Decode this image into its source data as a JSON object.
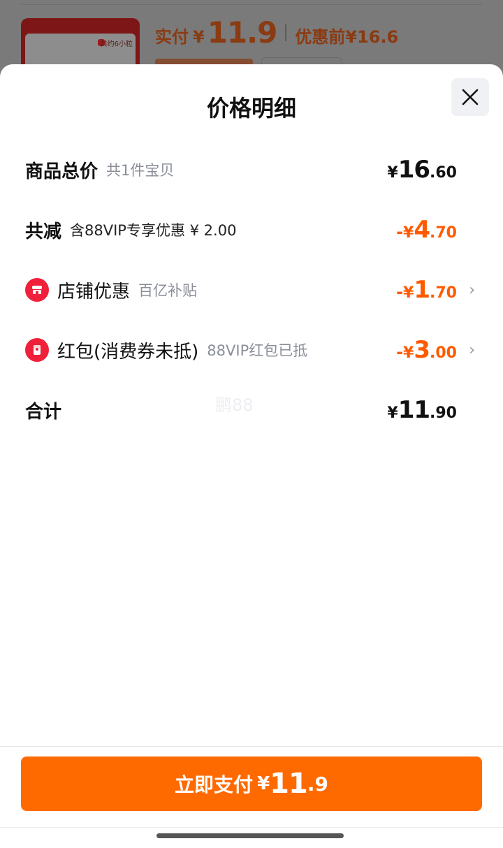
{
  "background_card": {
    "thumb_tag": "共约6小粒",
    "paid_label": "实付",
    "paid_yen": "¥",
    "paid_price": "11.9",
    "original_label": "优惠前",
    "original_price": "¥16.6"
  },
  "sheet": {
    "title": "价格明细",
    "close_icon": "close-icon"
  },
  "rows": {
    "goods_total": {
      "label": "商品总价",
      "sub": "共1件宝贝",
      "yen": "¥",
      "int": "16",
      "dec": ".60"
    },
    "total_discount": {
      "label": "共减",
      "sub": "含88VIP专享优惠 ¥ 2.00",
      "sign": "-",
      "yen": "¥",
      "int": "4",
      "dec": ".70"
    },
    "shop_discount": {
      "icon": "shop-icon",
      "label": "店铺优惠",
      "sub": "百亿补贴",
      "sign": "-",
      "yen": "¥",
      "int": "1",
      "dec": ".70",
      "chevron": "›"
    },
    "red_packet": {
      "icon": "red-packet-icon",
      "label": "红包(消费券未抵)",
      "sub": "88VIP红包已抵",
      "sign": "-",
      "yen": "¥",
      "int": "3",
      "dec": ".00",
      "chevron": "›"
    },
    "sum": {
      "label": "合计",
      "yen": "¥",
      "int": "11",
      "dec": ".90"
    }
  },
  "watermark": "鹏88",
  "pay_button": {
    "label": "立即支付",
    "yen": "¥",
    "int": "11",
    "dec": ".9"
  },
  "colors": {
    "accent": "#ff6a00",
    "discount": "#ff5a00",
    "icon_red": "#f0203a"
  }
}
